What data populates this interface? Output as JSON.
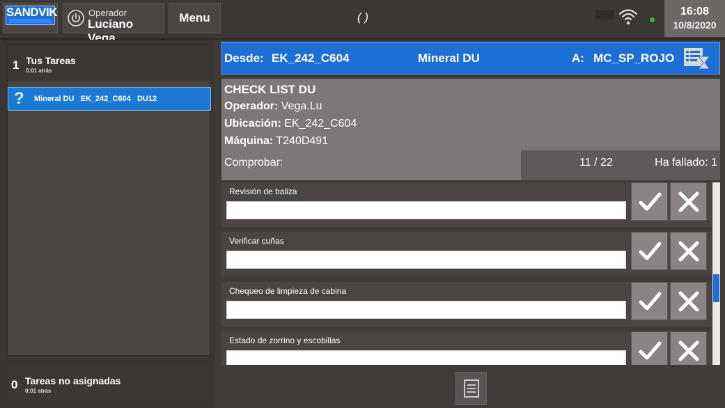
{
  "header": {
    "logo_text": "SANDVIK",
    "operator_label": "Operador",
    "operator_name": "Luciano Vega",
    "menu_label": "Menu",
    "center_status": "( )",
    "time": "16:08",
    "date": "10/8/2020",
    "icons": [
      "power-icon",
      "battery-icon",
      "wifi-icon"
    ],
    "signal_color": "#22c23c"
  },
  "sidebar": {
    "my_tasks": {
      "count": "1",
      "title": "Tus Tareas",
      "ago": "0:01 atrás"
    },
    "items": [
      {
        "icon": "question-icon",
        "label": "Mineral DU   EK_242_C604   DU12"
      }
    ],
    "unassigned": {
      "count": "0",
      "title": "Tareas no asignadas",
      "ago": "0:01 atrás"
    }
  },
  "route": {
    "from_label": "Desde:",
    "from_value": "EK_242_C604",
    "material": "Mineral DU",
    "to_label": "A:",
    "to_value": "MC_SP_ROJO",
    "accent": "#1d6fd6"
  },
  "checklist": {
    "title": "CHECK LIST DU",
    "operator_label": "Operador:",
    "operator_value": "Vega.Lu",
    "location_label": "Ubicación:",
    "location_value": "EK_242_C604",
    "machine_label": "Máquina:",
    "machine_value": "T240D491",
    "check_label": "Comprobar:",
    "progress": "11  /  22",
    "failed_label": "Ha fallado: 1",
    "items": [
      {
        "label": "Revisión de baliza",
        "value": ""
      },
      {
        "label": "Verificar cuñas",
        "value": ""
      },
      {
        "label": "Chequeo de limpieza de cabina",
        "value": ""
      },
      {
        "label": "Estado de zorrino y escobillas",
        "value": ""
      }
    ]
  }
}
